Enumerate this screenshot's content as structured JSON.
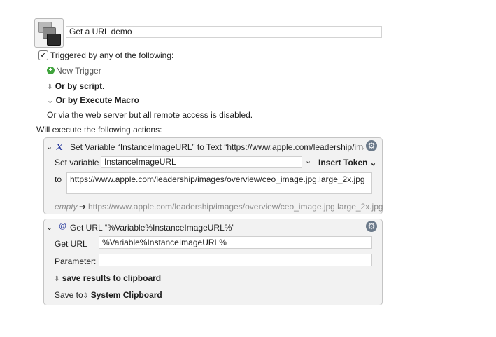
{
  "macro": {
    "name": "Get a URL demo",
    "trigger_checkbox_label": "Triggered by any of the following:",
    "triggered": true,
    "new_trigger_label": "New Trigger",
    "or_by_script_label": "Or by script.",
    "or_by_execute_macro_label": "Or by Execute Macro",
    "web_server_note": "Or via the web server but all remote access is disabled.",
    "actions_heading": "Will execute the following actions:"
  },
  "actions": [
    {
      "title": "Set Variable “InstanceImageURL” to Text “https://www.apple.com/leadership/ima...",
      "set_variable_label": "Set variable",
      "variable_name": "InstanceImageURL",
      "insert_token_label": "Insert Token",
      "to_label": "to",
      "to_value": "https://www.apple.com/leadership/images/overview/ceo_image.jpg.large_2x.jpg",
      "preview_empty": "empty",
      "preview_arrow": "➔",
      "preview_value": "https://www.apple.com/leadership/images/overview/ceo_image.jpg.large_2x.jpg"
    },
    {
      "title": "Get URL “%Variable%InstanceImageURL%”",
      "get_url_label": "Get URL",
      "get_url_value": "%Variable%InstanceImageURL%",
      "parameter_label": "Parameter:",
      "parameter_value": "",
      "save_results_label": "save results to clipboard",
      "save_to_label": "Save to",
      "save_to_value": "System Clipboard"
    }
  ],
  "icons": {
    "checkmark": "✓",
    "plus": "+",
    "gear": "⚙",
    "chevron_down": "⌄",
    "updown": "⌃⌄",
    "variable_x": "x",
    "at": "@"
  },
  "colors": {
    "accent_green": "#3fa33c",
    "variable_icon_blue": "#2b3c9e",
    "gear_blue_gray": "#6c7a8a"
  }
}
